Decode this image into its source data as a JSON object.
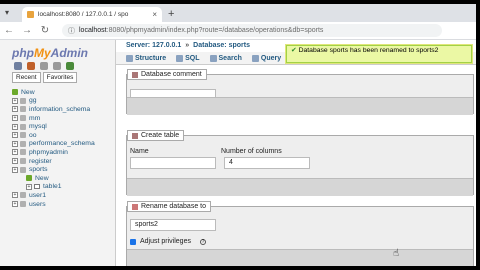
{
  "browser": {
    "tab_title": "localhost:8080 / 127.0.0.1 / spo",
    "tab_close": "×",
    "new_tab": "+",
    "back": "←",
    "forward": "→",
    "reload": "↻",
    "url_host": "localhost",
    "url_rest": ":8080/phpmyadmin/index.php?route=/database/operations&db=sports"
  },
  "sidebar": {
    "logo_php": "php",
    "logo_my": "My",
    "logo_admin": "Admin",
    "recent_tab": "Recent",
    "favorites_tab": "Favorites",
    "items": [
      {
        "label": "New",
        "kind": "new"
      },
      {
        "label": "gg",
        "kind": "db"
      },
      {
        "label": "information_schema",
        "kind": "db"
      },
      {
        "label": "mm",
        "kind": "db"
      },
      {
        "label": "mysql",
        "kind": "db"
      },
      {
        "label": "oo",
        "kind": "db"
      },
      {
        "label": "performance_schema",
        "kind": "db"
      },
      {
        "label": "phpmyadmin",
        "kind": "db"
      },
      {
        "label": "register",
        "kind": "db"
      },
      {
        "label": "sports",
        "kind": "db"
      },
      {
        "label": "New",
        "kind": "child-new"
      },
      {
        "label": "table1",
        "kind": "child-table"
      },
      {
        "label": "user1",
        "kind": "db"
      },
      {
        "label": "users",
        "kind": "db"
      }
    ]
  },
  "breadcrumb": {
    "server": "Server: 127.0.0.1",
    "separator": "»",
    "database": "Database: sports"
  },
  "tabs": [
    {
      "label": "Structure"
    },
    {
      "label": "SQL"
    },
    {
      "label": "Search"
    },
    {
      "label": "Query"
    }
  ],
  "notice": {
    "check": "✔",
    "text": "Database sports has been renamed to sports2"
  },
  "comment_section": {
    "legend": "Database comment",
    "value": ""
  },
  "create_table": {
    "legend": "Create table",
    "name_label": "Name",
    "name_value": "",
    "columns_label": "Number of columns",
    "columns_value": "4"
  },
  "rename_section": {
    "legend": "Rename database to",
    "value": "sports2",
    "adjust_label": "Adjust privileges"
  },
  "colors": {
    "notice_bg": "#ebf8a4",
    "link": "#235a81",
    "logo_orange": "#f29111"
  }
}
